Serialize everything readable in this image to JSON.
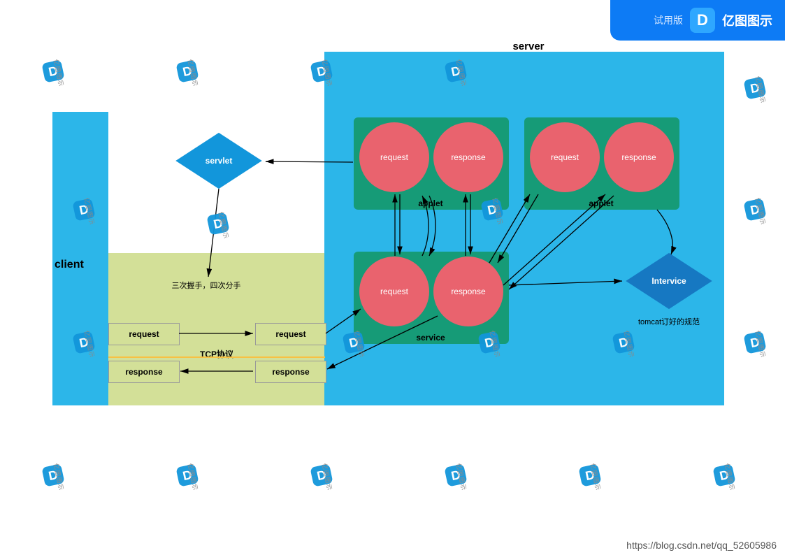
{
  "banner": {
    "trial": "试用版",
    "brand": "亿图图示"
  },
  "footer": "https://blog.csdn.net/qq_52605986",
  "watermark_text": "亿图图示",
  "client": {
    "title": "client",
    "handshake": "三次握手，四次分手",
    "tcp_protocol": "TCP协议",
    "left_request": "request",
    "left_response": "response",
    "right_request": "request",
    "right_response": "response"
  },
  "servlet": "servlet",
  "server": {
    "title": "server",
    "applet1": {
      "label": "applet",
      "request": "request",
      "response": "response"
    },
    "applet2": {
      "label": "applet",
      "request": "request",
      "response": "response"
    },
    "service": {
      "label": "service",
      "request": "request",
      "response": "response"
    },
    "intervice": {
      "label": "Intervice",
      "caption": "tomcat订好的规范"
    }
  },
  "colors": {
    "cyan": "#2cb6e9",
    "olive": "#d3e098",
    "teal": "#169b77",
    "coral": "#e9636e",
    "blue": "#1296db",
    "darkblue": "#1678c2"
  }
}
